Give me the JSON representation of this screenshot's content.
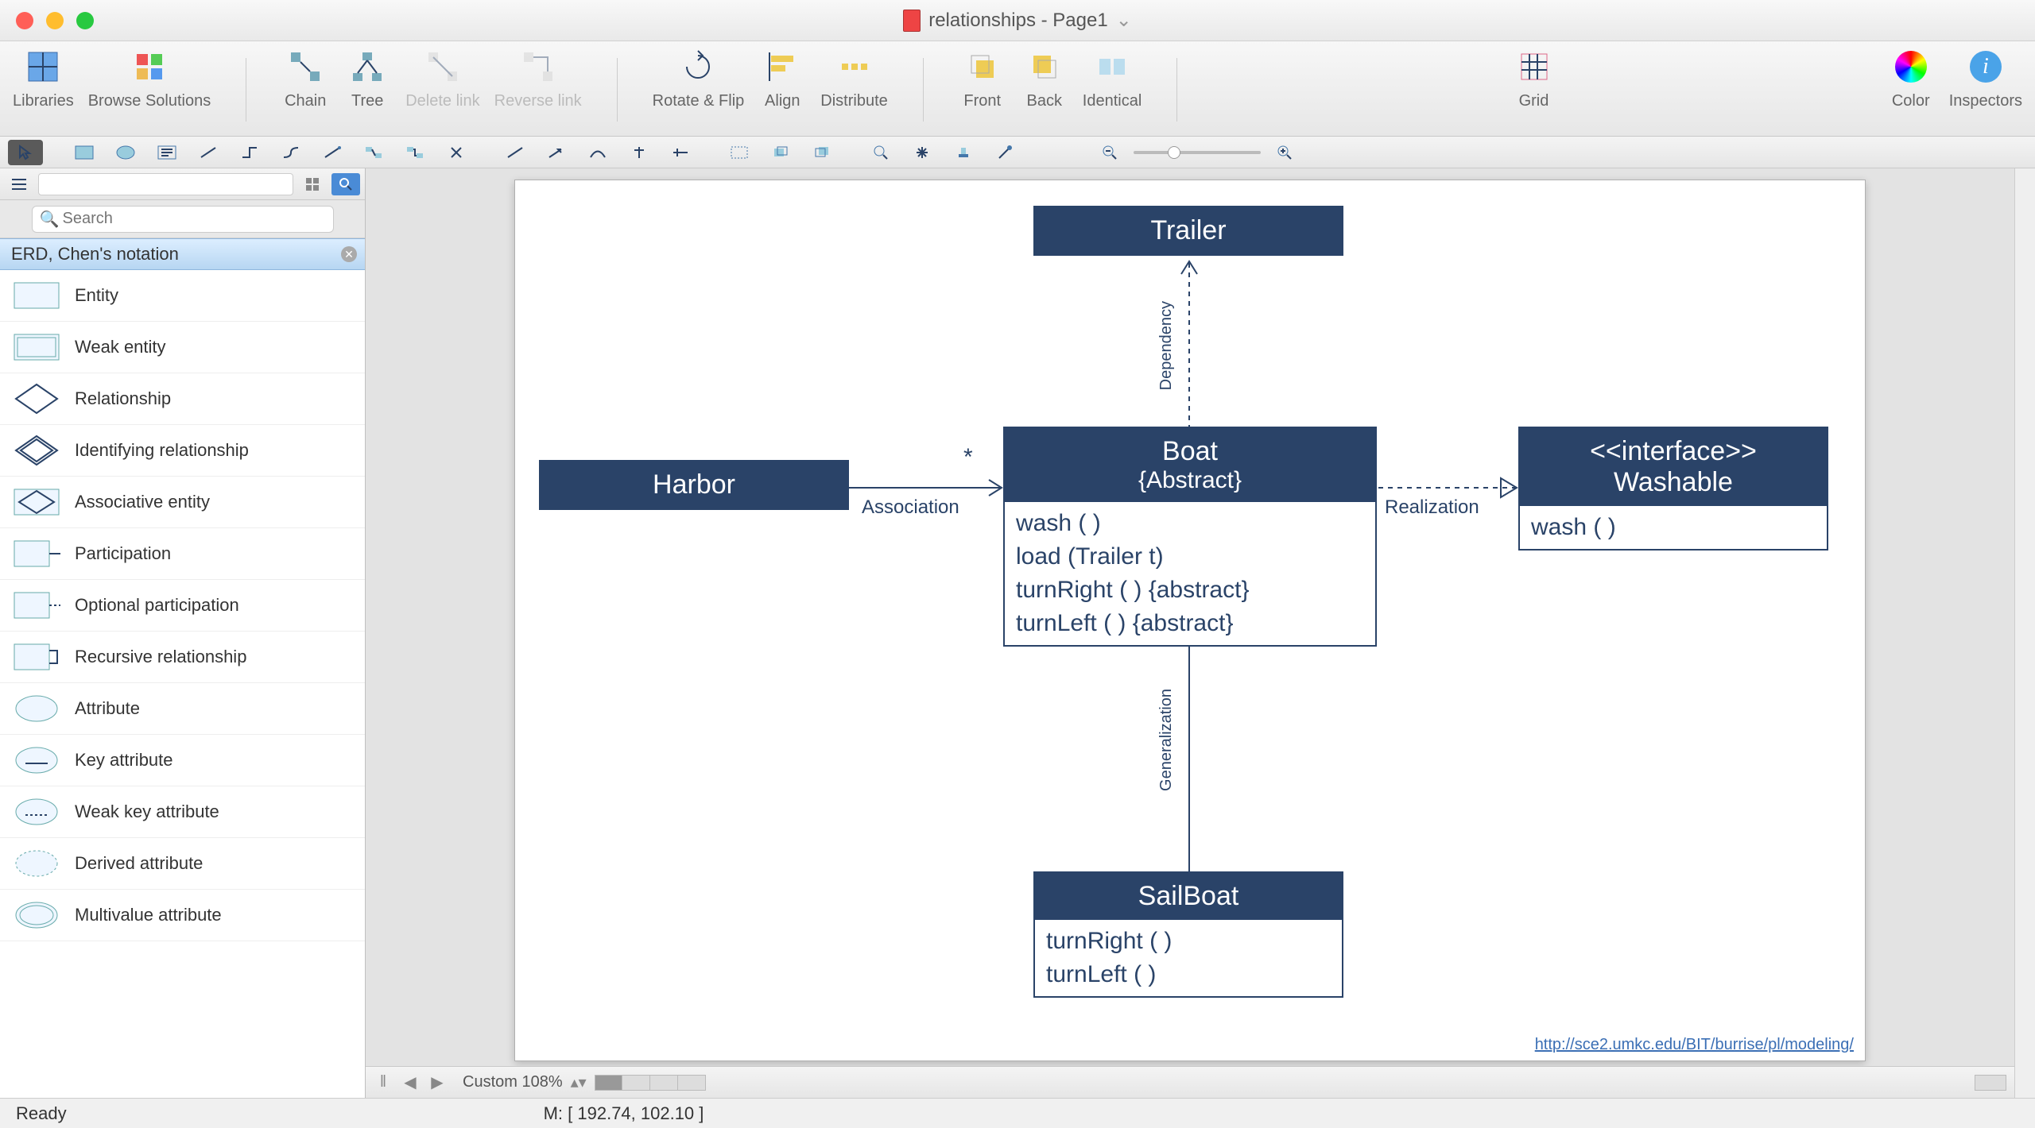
{
  "window": {
    "title": "relationships - Page1"
  },
  "toolbar": {
    "libraries": "Libraries",
    "browse": "Browse Solutions",
    "chain": "Chain",
    "tree": "Tree",
    "delete_link": "Delete link",
    "reverse_link": "Reverse link",
    "rotate_flip": "Rotate & Flip",
    "align": "Align",
    "distribute": "Distribute",
    "front": "Front",
    "back": "Back",
    "identical": "Identical",
    "grid": "Grid",
    "color": "Color",
    "inspectors": "Inspectors"
  },
  "sidebar": {
    "search_placeholder": "Search",
    "category": "ERD, Chen's notation",
    "items": [
      {
        "label": "Entity",
        "thumb": "rect"
      },
      {
        "label": "Weak entity",
        "thumb": "rect2"
      },
      {
        "label": "Relationship",
        "thumb": "diamond"
      },
      {
        "label": "Identifying relationship",
        "thumb": "diamond2"
      },
      {
        "label": "Associative entity",
        "thumb": "diamondfill"
      },
      {
        "label": "Participation",
        "thumb": "rectline"
      },
      {
        "label": "Optional participation",
        "thumb": "rectdash"
      },
      {
        "label": "Recursive relationship",
        "thumb": "rectloop"
      },
      {
        "label": "Attribute",
        "thumb": "ellipse"
      },
      {
        "label": "Key attribute",
        "thumb": "ellipseU"
      },
      {
        "label": "Weak key attribute",
        "thumb": "ellipseD"
      },
      {
        "label": "Derived attribute",
        "thumb": "ellipseDash"
      },
      {
        "label": "Multivalue attribute",
        "thumb": "ellipse2"
      }
    ]
  },
  "diagram": {
    "trailer": {
      "title": "Trailer"
    },
    "harbor": {
      "title": "Harbor"
    },
    "boat": {
      "title": "Boat",
      "subtitle": "{Abstract}",
      "body": "wash ( )\nload (Trailer t)\nturnRight ( ) {abstract}\nturnLeft ( ) {abstract}"
    },
    "washable": {
      "title1": "<<interface>>",
      "title2": "Washable",
      "body": "wash ( )"
    },
    "sailboat": {
      "title": "SailBoat",
      "body": "turnRight ( )\nturnLeft ( )"
    },
    "labels": {
      "association": "Association",
      "star": "*",
      "dependency": "Dependency",
      "realization": "Realization",
      "generalization": "Generalization"
    },
    "url": "http://sce2.umkc.edu/BIT/burrise/pl/modeling/"
  },
  "bottom": {
    "zoom": "Custom 108%"
  },
  "status": {
    "ready": "Ready",
    "mouse": "M: [ 192.74, 102.10 ]"
  }
}
